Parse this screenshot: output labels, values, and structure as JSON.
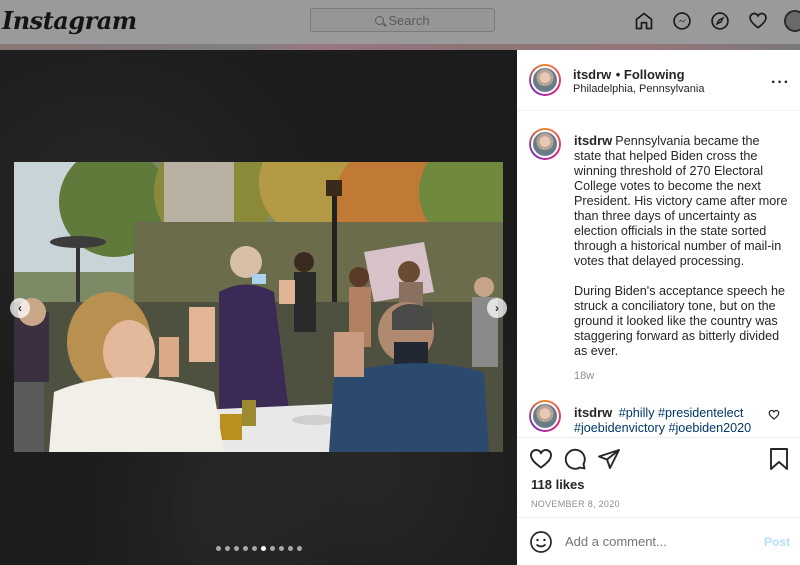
{
  "nav": {
    "logo": "Instagram",
    "search_placeholder": "Search"
  },
  "post": {
    "username": "itsdrw",
    "following": "• Following",
    "location": "Philadelphia, Pennsylvania",
    "caption_p1": "Pennsylvania became the state that helped Biden cross the winning threshold of 270 Electoral College votes to become the next President. His victory came after more than three days of uncertainty as election officials in the state sorted through a historical number of mail-in votes that delayed processing.",
    "caption_p2": "During Biden's acceptance speech he struck a conciliatory tone, but on the ground it looked like the country was staggering forward as bitterly divided as ever.",
    "caption_age": "18w",
    "comment": {
      "username": "itsdrw",
      "tags": "#philly #presidentelect #joebidenvictory #joebiden2020"
    },
    "likes": "118 likes",
    "date": "NOVEMBER 8, 2020",
    "add_comment_placeholder": "Add a comment...",
    "post_label": "Post"
  },
  "carousel": {
    "count": 10,
    "active_index": 5
  }
}
